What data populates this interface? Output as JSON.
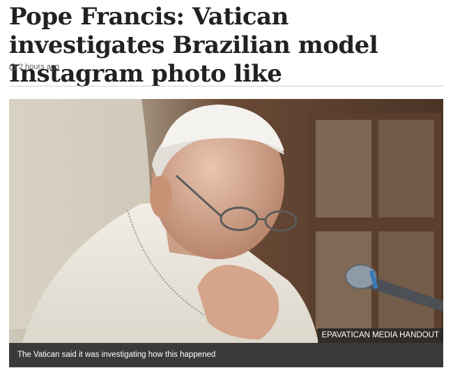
{
  "article": {
    "headline": "Pope Francis: Vatican investigates Brazilian model Instagram photo like",
    "timestamp": "2 hours ago",
    "timestamp_icon": "clock-icon"
  },
  "image": {
    "credit": "EPAVATICAN MEDIA HANDOUT",
    "caption": "The Vatican said it was investigating how this happened"
  },
  "colors": {
    "headline": "#222222",
    "caption_background": "#3a3a3a",
    "credit_background": "#282828"
  }
}
